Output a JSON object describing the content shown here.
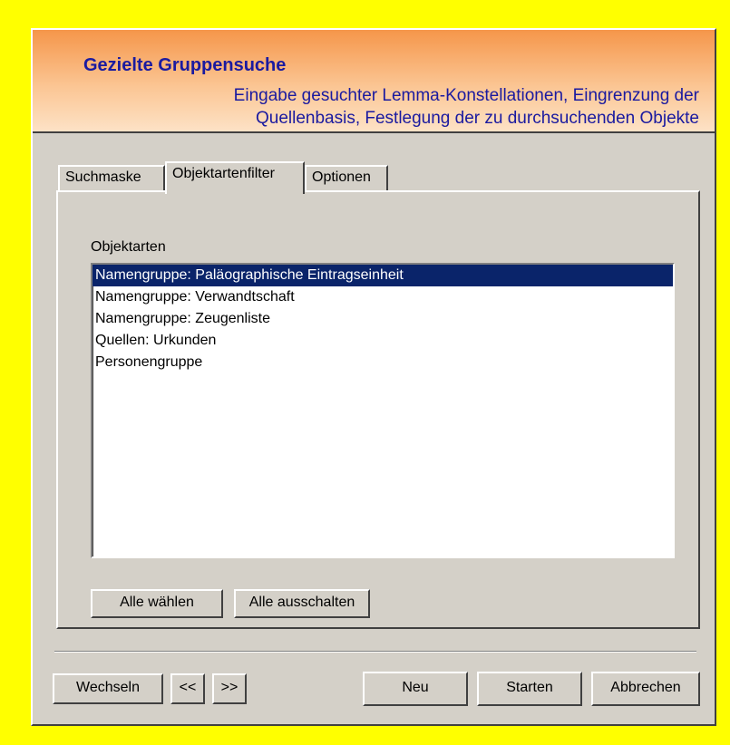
{
  "header": {
    "title": "Gezielte Gruppensuche",
    "subtitle": "Eingabe gesuchter Lemma-Konstellationen, Eingrenzung der\nQuellenbasis, Festlegung der zu durchsuchenden Objekte"
  },
  "tabs": [
    {
      "label": "Suchmaske"
    },
    {
      "label": "Objektartenfilter",
      "active": true
    },
    {
      "label": "Optionen"
    }
  ],
  "panel": {
    "list_label": "Objektarten",
    "items": [
      {
        "label": "Namengruppe: Paläographische Eintragseinheit",
        "selected": true
      },
      {
        "label": "Namengruppe: Verwandtschaft"
      },
      {
        "label": "Namengruppe: Zeugenliste"
      },
      {
        "label": "Quellen: Urkunden"
      },
      {
        "label": "Personengruppe"
      }
    ],
    "select_all_label": "Alle wählen",
    "deselect_all_label": "Alle ausschalten"
  },
  "footer": {
    "switch_label": "Wechseln",
    "prev_label": "<<",
    "next_label": ">>",
    "new_label": "Neu",
    "start_label": "Starten",
    "cancel_label": "Abbrechen"
  },
  "colors": {
    "frame": "#ffff00",
    "header_gradient_top": "#f5964a",
    "header_gradient_bottom": "#fde2c6",
    "header_text": "#1a1aa0",
    "selection": "#0a246a",
    "dialog_bg": "#d4d0c8"
  }
}
